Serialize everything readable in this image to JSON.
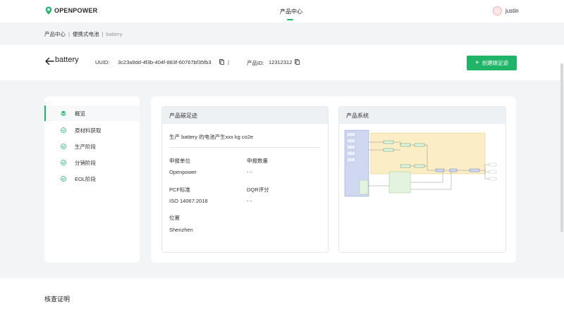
{
  "brand": {
    "logo_text": "OPENPOWER",
    "accent": "#1fb468"
  },
  "nav": {
    "center_label": "产品中心"
  },
  "user": {
    "name": "justin"
  },
  "breadcrumb": {
    "items": [
      "产品中心",
      "便携式电池",
      "battery"
    ]
  },
  "product": {
    "title": "battery",
    "uuid_label": "UUID:",
    "uuid_value": "3c23a9dd-4f3b-404f-883f-60767bf35fb3",
    "separator": "|",
    "pid_label": "产品ID:",
    "pid_value": "12312312"
  },
  "actions": {
    "create_label": "创建碳足迹",
    "create_icon": "+"
  },
  "sidebar": {
    "items": [
      {
        "label": "概览",
        "icon": "layers-icon",
        "active": true
      },
      {
        "label": "原材料获取",
        "icon": "check-circle-icon",
        "active": false
      },
      {
        "label": "生产阶段",
        "icon": "check-circle-icon",
        "active": false
      },
      {
        "label": "分销阶段",
        "icon": "check-circle-icon",
        "active": false
      },
      {
        "label": "EOL阶段",
        "icon": "check-circle-icon",
        "active": false
      }
    ]
  },
  "carbon_card": {
    "title": "产品碳足迹",
    "description": "生产 battery 的电池产生xxx kg co2e",
    "fields": [
      {
        "label": "申报单位",
        "value": "Openpower"
      },
      {
        "label": "申报数量",
        "value": "- -"
      },
      {
        "label": "PCF标准",
        "value": "ISO 14067:2018"
      },
      {
        "label": "DQR评分",
        "value": "- -"
      },
      {
        "label": "位置",
        "value": "Shenzhen"
      }
    ]
  },
  "system_card": {
    "title": "产品系统"
  },
  "verification": {
    "title": "核查证明"
  }
}
